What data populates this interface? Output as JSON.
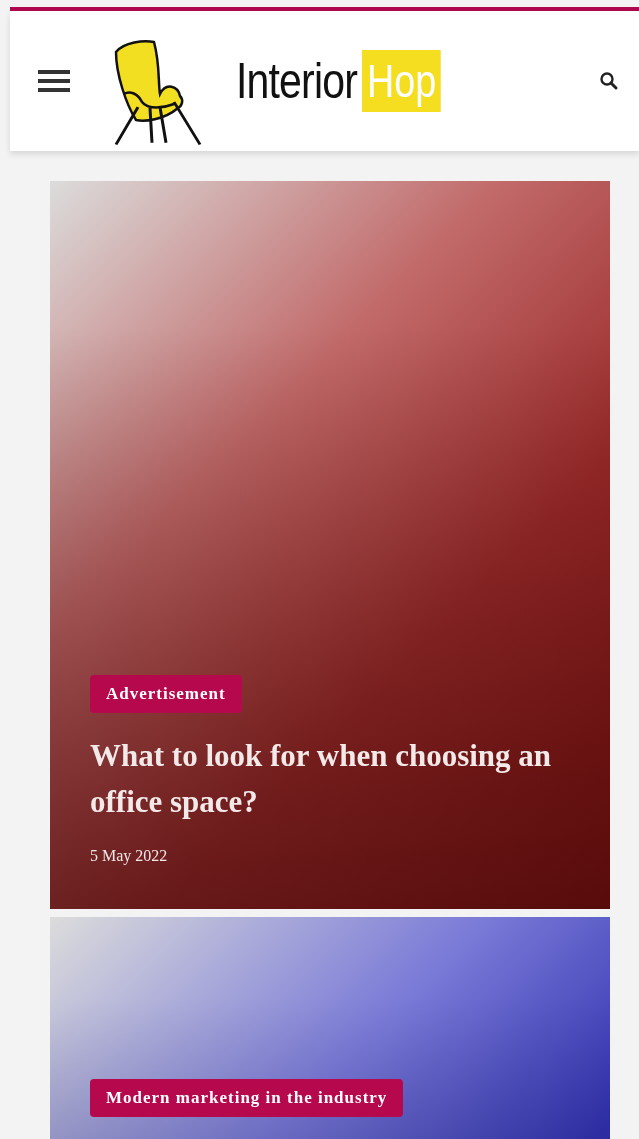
{
  "header": {
    "logo": {
      "word": "Interior",
      "highlight": "Hop"
    }
  },
  "articles": [
    {
      "tag": "Advertisement",
      "title": "What to look for when choosing an office space?",
      "date": "5 May 2022"
    },
    {
      "tag": "Modern marketing in the industry"
    }
  ]
}
